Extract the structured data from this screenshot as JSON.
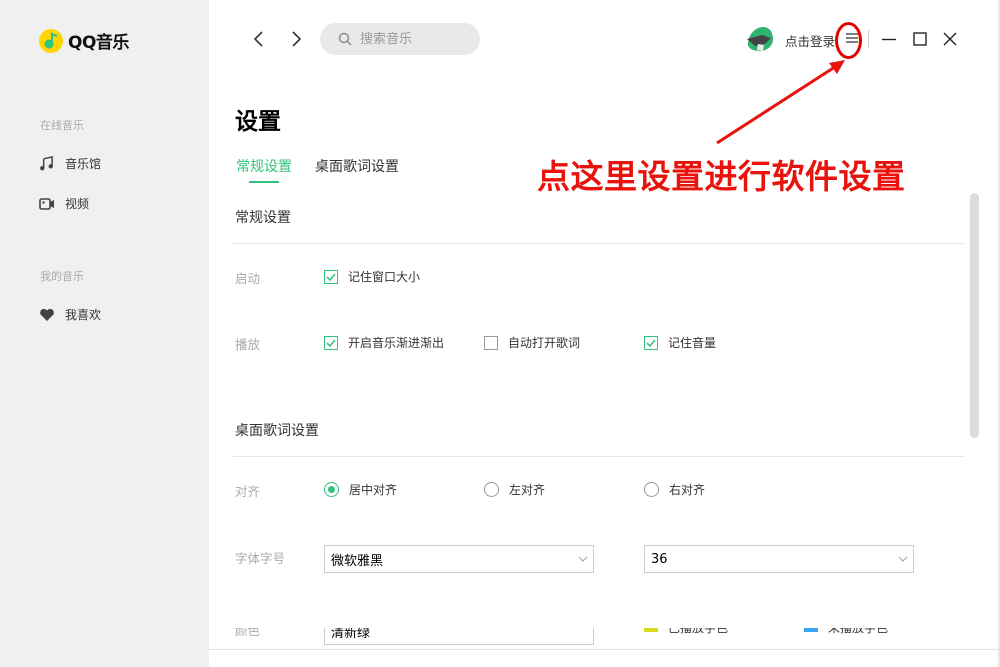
{
  "app": {
    "name": "QQ音乐"
  },
  "sidebar": {
    "sections": [
      {
        "title": "在线音乐",
        "items": [
          {
            "label": "音乐馆",
            "icon": "music-note-icon"
          },
          {
            "label": "视频",
            "icon": "video-icon"
          }
        ]
      },
      {
        "title": "我的音乐",
        "items": [
          {
            "label": "我喜欢",
            "icon": "heart-icon"
          }
        ]
      }
    ]
  },
  "header": {
    "search_placeholder": "搜索音乐",
    "login_label": "点击登录"
  },
  "annotation": {
    "text": "点这里设置进行软件设置",
    "color": "#e8130d"
  },
  "settings": {
    "title": "设置",
    "tabs": [
      {
        "label": "常规设置",
        "active": true
      },
      {
        "label": "桌面歌词设置",
        "active": false
      }
    ],
    "general": {
      "title": "常规设置",
      "startup_label": "启动",
      "startup_options": [
        {
          "label": "记住窗口大小",
          "checked": true
        }
      ],
      "playback_label": "播放",
      "playback_options": [
        {
          "label": "开启音乐渐进渐出",
          "checked": true
        },
        {
          "label": "自动打开歌词",
          "checked": false
        },
        {
          "label": "记住音量",
          "checked": true
        }
      ]
    },
    "lyrics": {
      "title": "桌面歌词设置",
      "align_label": "对齐",
      "align_options": [
        {
          "label": "居中对齐",
          "selected": true
        },
        {
          "label": "左对齐",
          "selected": false
        },
        {
          "label": "右对齐",
          "selected": false
        }
      ],
      "font_label": "字体字号",
      "font_family": "微软雅黑",
      "font_size": "36",
      "color_label": "颜色",
      "color_scheme": "清新绿",
      "played_color_label": "已播放字色",
      "played_color": "#d6dc1a",
      "unplayed_color_label": "未播放字色",
      "unplayed_color": "#3aa5f0"
    }
  },
  "colors": {
    "accent": "#31c27c",
    "sidebar_bg": "#f0f0f0"
  }
}
